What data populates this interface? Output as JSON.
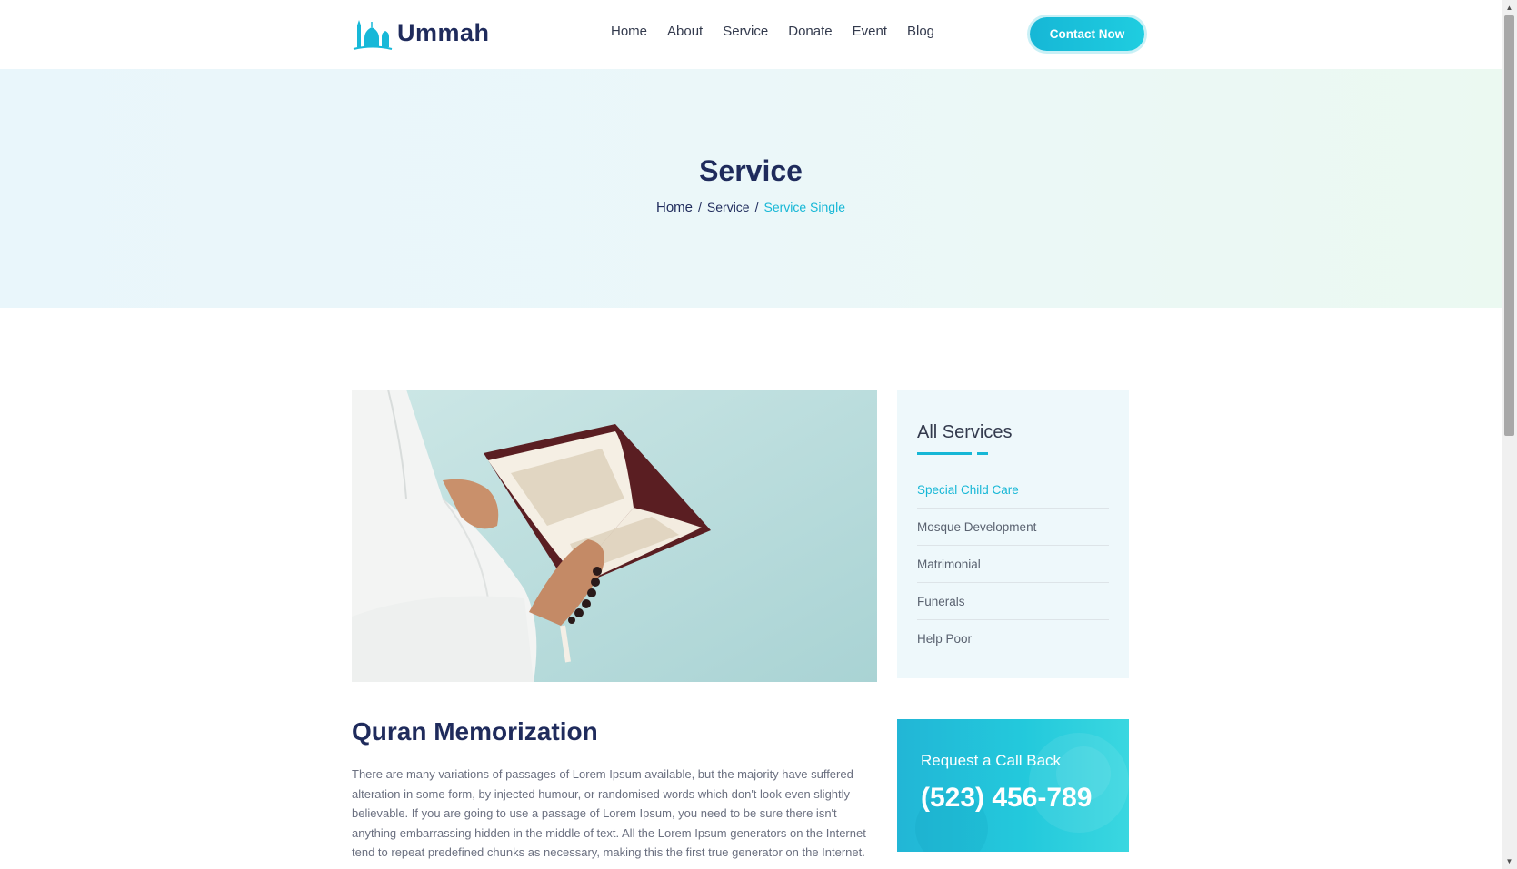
{
  "header": {
    "logo_text": "Ummah",
    "nav": [
      {
        "label": "Home"
      },
      {
        "label": "About"
      },
      {
        "label": "Service"
      },
      {
        "label": "Donate"
      },
      {
        "label": "Event"
      },
      {
        "label": "Blog"
      }
    ],
    "contact_label": "Contact Now"
  },
  "hero": {
    "title": "Service",
    "breadcrumb": [
      "Home",
      "Service",
      "Service Single"
    ],
    "separator": "/"
  },
  "sidebar": {
    "title": "All Services",
    "items": [
      {
        "label": "Special Child Care",
        "active": true
      },
      {
        "label": "Mosque Development",
        "active": false
      },
      {
        "label": "Matrimonial",
        "active": false
      },
      {
        "label": "Funerals",
        "active": false
      },
      {
        "label": "Help Poor",
        "active": false
      }
    ]
  },
  "content": {
    "title": "Quran Memorization",
    "text": "There are many variations of passages of Lorem Ipsum available, but the majority have suffered alteration in some form, by injected humour, or randomised words which don't look even slightly believable. If you are going to use a passage of Lorem Ipsum, you need to be sure there isn't anything embarrassing hidden in the middle of text. All the Lorem Ipsum generators on the Internet tend to repeat predefined chunks as necessary, making this the first true generator on the Internet."
  },
  "callback": {
    "label": "Request a Call Back",
    "phone": "(523) 456-789"
  },
  "colors": {
    "accent": "#16b7d6",
    "heading": "#1f2b5c"
  },
  "icons": {
    "logo": "mosque-icon",
    "scroll_up": "triangle-up-icon",
    "scroll_down": "triangle-down-icon"
  }
}
